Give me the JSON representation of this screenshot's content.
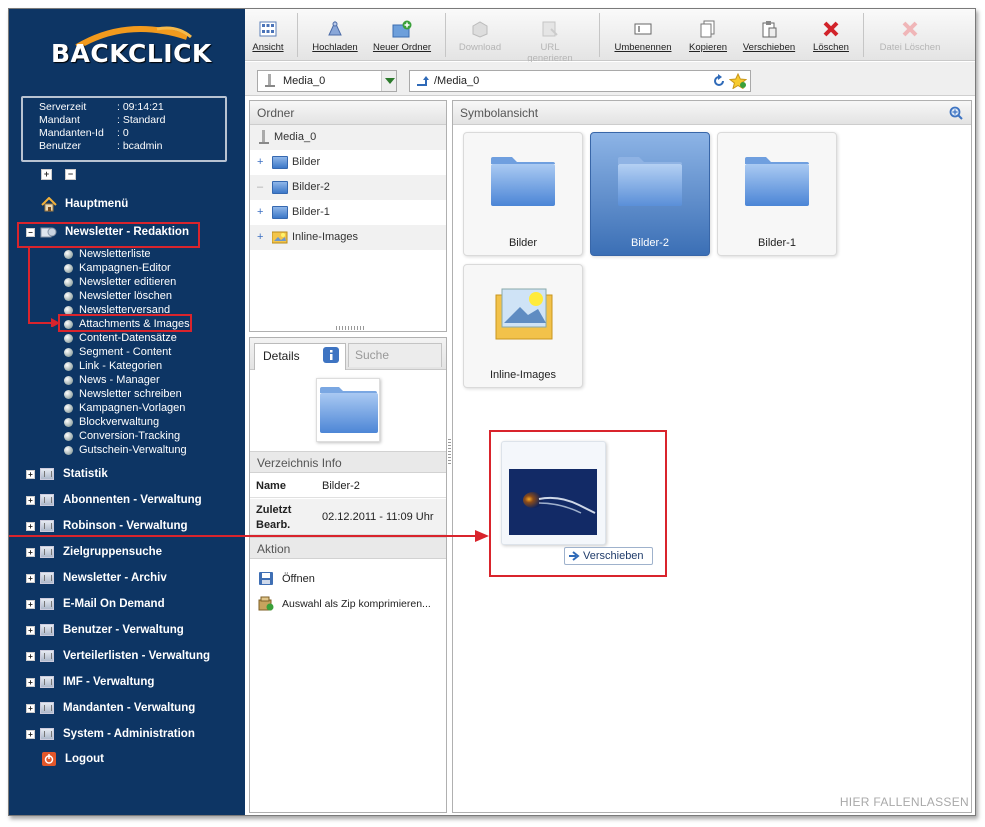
{
  "app": {
    "logo": "BACKCLICK"
  },
  "server_info": [
    {
      "key": "Serverzeit",
      "value": ": 09:14:21"
    },
    {
      "key": "Mandant",
      "value": ": Standard"
    },
    {
      "key": "Mandanten-Id",
      "value": ": 0"
    },
    {
      "key": "Benutzer",
      "value": ": bcadmin"
    }
  ],
  "nav": {
    "home": "Hauptmenü",
    "newsletter_redaktion": "Newsletter - Redaktion",
    "sub_items": [
      "Newsletterliste",
      "Kampagnen-Editor",
      "Newsletter editieren",
      "Newsletter löschen",
      "Newsletterversand",
      "Attachments & Images",
      "Content-Datensätze",
      "Segment - Content",
      "Link - Kategorien",
      "News - Manager",
      "Newsletter schreiben",
      "Kampagnen-Vorlagen",
      "Blockverwaltung",
      "Conversion-Tracking",
      "Gutschein-Verwaltung"
    ],
    "sections": [
      "Statistik",
      "Abonnenten - Verwaltung",
      "Robinson - Verwaltung",
      "Zielgruppensuche",
      "Newsletter - Archiv",
      "E-Mail On Demand",
      "Benutzer - Verwaltung",
      "Verteilerlisten - Verwaltung",
      "IMF - Verwaltung",
      "Mandanten - Verwaltung",
      "System - Administration"
    ],
    "logout": "Logout"
  },
  "toolbar": {
    "ansicht": "Ansicht",
    "hochladen": "Hochladen",
    "neuer_ordner": "Neuer Ordner",
    "download": "Download",
    "url_generieren": "URL generieren",
    "umbenennen": "Umbenennen",
    "kopieren": "Kopieren",
    "verschieben": "Verschieben",
    "loeschen": "Löschen",
    "datei_loeschen": "Datei Löschen"
  },
  "pathbar": {
    "selected": "Media_0",
    "path": "/Media_0"
  },
  "folder_panel": {
    "title": "Ordner",
    "root": "Media_0",
    "items": [
      "Bilder",
      "Bilder-2",
      "Bilder-1",
      "Inline-Images"
    ]
  },
  "details": {
    "tab_details": "Details",
    "tab_search": "Suche",
    "info_title": "Verzeichnis Info",
    "name_label": "Name",
    "name_value": "Bilder-2",
    "date_label": "Zuletzt Bearb.",
    "date_value": "02.12.2011 - 11:09 Uhr",
    "action_title": "Aktion",
    "action_open": "Öffnen",
    "action_zip": "Auswahl als Zip komprimieren..."
  },
  "icon_view": {
    "title": "Symbolansicht",
    "tiles": [
      "Bilder",
      "Bilder-2",
      "Bilder-1",
      "Inline-Images"
    ],
    "drag_label": "Verschieben",
    "drop_hint": "HIER FALLENLASSEN"
  }
}
